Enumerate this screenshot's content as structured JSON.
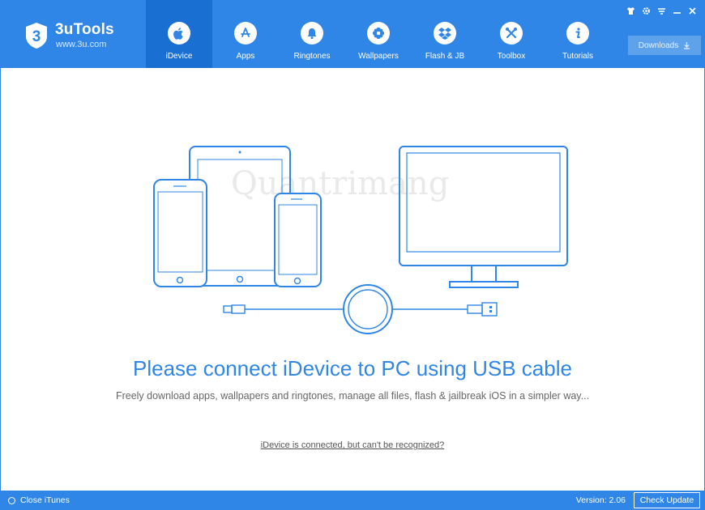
{
  "app": {
    "name": "3uTools",
    "url": "www.3u.com",
    "badge": "3"
  },
  "nav": [
    {
      "label": "iDevice",
      "icon": "apple-icon",
      "active": true
    },
    {
      "label": "Apps",
      "icon": "app-store-icon",
      "active": false
    },
    {
      "label": "Ringtones",
      "icon": "bell-icon",
      "active": false
    },
    {
      "label": "Wallpapers",
      "icon": "flower-icon",
      "active": false
    },
    {
      "label": "Flash & JB",
      "icon": "dropbox-icon",
      "active": false
    },
    {
      "label": "Toolbox",
      "icon": "tools-icon",
      "active": false
    },
    {
      "label": "Tutorials",
      "icon": "info-icon",
      "active": false
    }
  ],
  "window_controls": [
    "shirt-icon",
    "gear-icon",
    "menu-icon",
    "minimize-icon",
    "close-icon"
  ],
  "downloads": {
    "label": "Downloads"
  },
  "watermark": "Quantrimang",
  "main": {
    "headline": "Please connect iDevice to PC using USB cable",
    "subline": "Freely download apps, wallpapers and ringtones, manage all files, flash & jailbreak iOS in a simpler way...",
    "help_link": "iDevice is connected, but can't be recognized?"
  },
  "footer": {
    "close_itunes": "Close iTunes",
    "version": "Version: 2.06",
    "check_update": "Check Update"
  },
  "colors": {
    "brand": "#2f86e6",
    "active_tab": "#1a6fd3",
    "text": "#666666"
  }
}
